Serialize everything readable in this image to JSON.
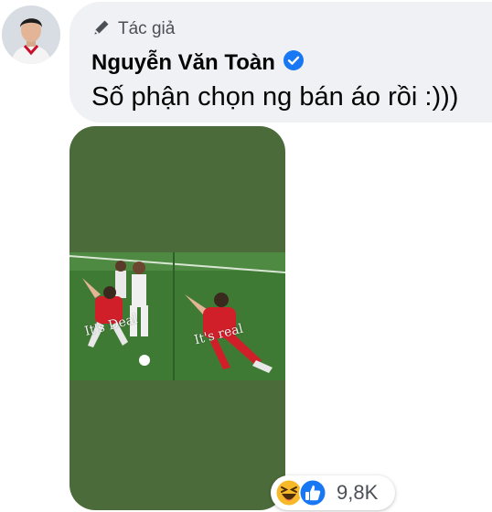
{
  "comment": {
    "badge_label": "Tác giả",
    "author_name": "Nguyễn Văn Toàn",
    "text": "Số phận chọn ng bán áo rồi :)))"
  },
  "media": {
    "caption_left": "It's Deal",
    "caption_right": "It's real"
  },
  "reactions": {
    "count": "9,8K",
    "icons": [
      "haha-icon",
      "like-icon"
    ]
  },
  "colors": {
    "bubble": "#eff1f4",
    "media_background": "#4c6b3a",
    "verified": "#1877f2",
    "like": "#1877f2",
    "haha": "#f7b928"
  }
}
